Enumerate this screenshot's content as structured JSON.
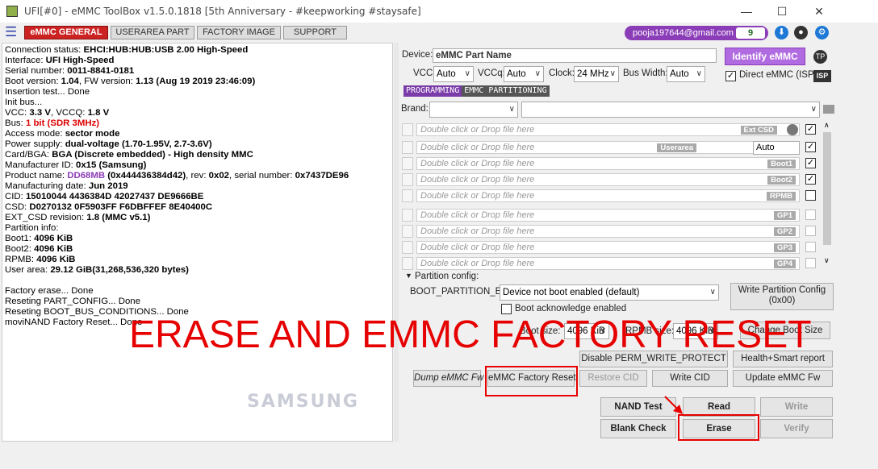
{
  "window": {
    "title": "UFI[#0] - eMMC ToolBox v1.5.0.1818 [5th Anniversary - #keepworking #staysafe]",
    "minimize": "—",
    "maximize": "☐",
    "close": "✕"
  },
  "tabs": [
    "eMMC GENERAL",
    "USERAREA PART",
    "FACTORY IMAGE",
    "SUPPORT"
  ],
  "user": {
    "email": "pooja197644@gmail.com",
    "count": "9"
  },
  "log_lines": [
    [
      {
        "t": "Connection status: "
      },
      {
        "t": "EHCI:HUB:HUB:USB 2.00 High-Speed",
        "c": "b"
      }
    ],
    [
      {
        "t": "Interface: "
      },
      {
        "t": "UFI High-Speed",
        "c": "b"
      }
    ],
    [
      {
        "t": "Serial number: "
      },
      {
        "t": "0011-8841-0181",
        "c": "b"
      }
    ],
    [
      {
        "t": " Boot version: "
      },
      {
        "t": "1.04",
        "c": "b"
      },
      {
        "t": ", FW version: "
      },
      {
        "t": "1.13 (Aug 19 2019 23:46:09)",
        "c": "b"
      }
    ],
    [
      {
        "t": "Insertion test... Done"
      }
    ],
    [
      {
        "t": "Init bus..."
      }
    ],
    [
      {
        "t": "VCC: "
      },
      {
        "t": "3.3 V",
        "c": "b"
      },
      {
        "t": ", VCCQ: "
      },
      {
        "t": "1.8 V",
        "c": "b"
      }
    ],
    [
      {
        "t": "Bus: "
      },
      {
        "t": "1 bit (SDR 3MHz)",
        "c": "red"
      }
    ],
    [
      {
        "t": "Access mode: "
      },
      {
        "t": "sector mode",
        "c": "b"
      }
    ],
    [
      {
        "t": "Power supply: "
      },
      {
        "t": "dual-voltage (1.70-1.95V, 2.7-3.6V)",
        "c": "b"
      }
    ],
    [
      {
        "t": " Card/BGA: "
      },
      {
        "t": "BGA (Discrete embedded) - High density MMC",
        "c": "b"
      }
    ],
    [
      {
        "t": " Manufacturer ID: "
      },
      {
        "t": "0x15 (Samsung)",
        "c": "b"
      }
    ],
    [
      {
        "t": " Product name: "
      },
      {
        "t": "DD68MB",
        "c": "purple"
      },
      {
        "t": " (0x444436384d42)",
        "c": "b"
      },
      {
        "t": ", rev: "
      },
      {
        "t": "0x02",
        "c": "b"
      },
      {
        "t": ", serial number: "
      },
      {
        "t": "0x7437DE96",
        "c": "b"
      }
    ],
    [
      {
        "t": " Manufacturing date: "
      },
      {
        "t": "Jun 2019",
        "c": "b"
      }
    ],
    [
      {
        "t": "CID: "
      },
      {
        "t": "15010044 4436384D 42027437 DE9666BE",
        "c": "b"
      }
    ],
    [
      {
        "t": "CSD: "
      },
      {
        "t": "D0270132 0F5903FF F6DBFFEF 8E40400C",
        "c": "b"
      }
    ],
    [
      {
        "t": "EXT_CSD revision: "
      },
      {
        "t": "1.8 (MMC v5.1)",
        "c": "b"
      }
    ],
    [
      {
        "t": "Partition info:"
      }
    ],
    [
      {
        "t": " Boot1: "
      },
      {
        "t": "4096 KiB",
        "c": "b"
      }
    ],
    [
      {
        "t": " Boot2: "
      },
      {
        "t": "4096 KiB",
        "c": "b"
      }
    ],
    [
      {
        "t": " RPMB: "
      },
      {
        "t": "4096 KiB",
        "c": "b"
      }
    ],
    [
      {
        "t": " User area: "
      },
      {
        "t": "29.12 GiB(31,268,536,320 bytes)",
        "c": "b"
      }
    ],
    [
      {
        "t": ""
      }
    ],
    [
      {
        "t": "Factory erase... Done"
      }
    ],
    [
      {
        "t": "Reseting PART_CONFIG... Done"
      }
    ],
    [
      {
        "t": "Reseting BOOT_BUS_CONDITIONS... Done"
      }
    ],
    [
      {
        "t": "moviNAND Factory Reset... Done"
      }
    ]
  ],
  "samsung_logo": "SAMSUNG",
  "device": {
    "label": "Device:",
    "placeholder": "eMMC Part Name",
    "identify": "Identify eMMC",
    "tp": "TP"
  },
  "power": {
    "vcc_label": "VCC:",
    "vcc": "Auto",
    "vccq_label": "VCCq:",
    "vccq": "Auto",
    "clock_label": "Clock:",
    "clock": "24 MHz",
    "buswidth_label": "Bus Width:",
    "buswidth": "Auto",
    "direct_label": "Direct eMMC (ISP)",
    "isp": "ISP"
  },
  "prog_tabs": [
    "PROGRAMMING",
    "EMMC PARTITIONING"
  ],
  "brand_label": "Brand:",
  "file_rows": [
    {
      "hint": "Double click or Drop file here",
      "tag": "Ext CSD",
      "checked": true
    },
    {
      "hint": "Double click or Drop file here",
      "tag": "Userarea",
      "extra": "Auto",
      "checked": true
    },
    {
      "hint": "Double click or Drop file here",
      "tag": "Boot1",
      "checked": true
    },
    {
      "hint": "Double click or Drop file here",
      "tag": "Boot2",
      "checked": true
    },
    {
      "hint": "Double click or Drop file here",
      "tag": "RPMB",
      "checked": false
    },
    {
      "hint": "Double click or Drop file here",
      "tag": "GP1",
      "checked": false
    },
    {
      "hint": "Double click or Drop file here",
      "tag": "GP2",
      "checked": false
    },
    {
      "hint": "Double click or Drop file here",
      "tag": "GP3",
      "checked": false
    },
    {
      "hint": "Double click or Drop file here",
      "tag": "GP4",
      "checked": false
    }
  ],
  "partition": {
    "header": "Partition config:",
    "boot_label": "BOOT_PARTITION_EN",
    "boot_value": "Device not boot enabled (default)",
    "write_btn_1": "Write Partition Config",
    "write_btn_2": "(0x00)",
    "boot_ack": "Boot acknowledge enabled",
    "boot_size_label": "Boot size:",
    "boot_size": "4096 KiB",
    "rpmb_size_label": "RPMB size:",
    "rpmb_size": "4096 KiB",
    "change_boot": "Change Boot Size"
  },
  "buttons": {
    "disable_perm": "Disable PERM_WRITE_PROTECT",
    "health": "Health+Smart report",
    "dump": "Dump eMMC Fw",
    "factory_reset": "eMMC Factory Reset",
    "restore_cid": "Restore CID",
    "write_cid": "Write CID",
    "update_fw": "Update eMMC Fw",
    "nand_test": "NAND Test",
    "read": "Read",
    "write": "Write",
    "blank_check": "Blank Check",
    "erase": "Erase",
    "verify": "Verify"
  },
  "overlay_text": "ERASE AND EMMC FACTORY RESET",
  "colors": {
    "accent_red": "#e60000",
    "purple": "#8b3db8",
    "tab_active": "#cc2222"
  }
}
